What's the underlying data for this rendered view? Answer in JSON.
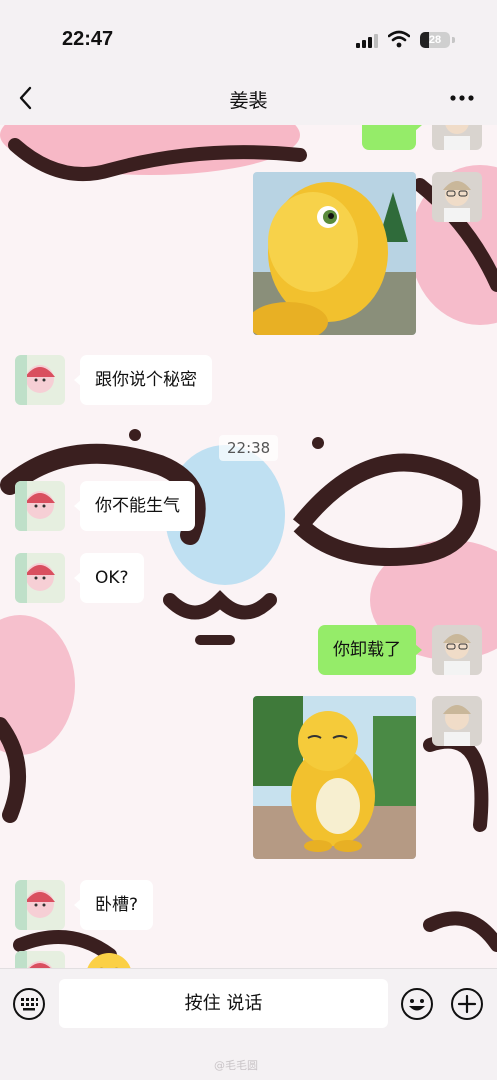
{
  "status_bar": {
    "time": "22:47",
    "battery": "28"
  },
  "header": {
    "title": "姜裴"
  },
  "messages": {
    "in_1": "跟你说个秘密",
    "timestamp": "22:38",
    "in_2": "你不能生气",
    "in_3": "OK?",
    "out_1": "你卸载了",
    "in_4": "卧槽?"
  },
  "input_bar": {
    "voice_label": "按住 说话"
  },
  "watermark": "@毛毛圆",
  "icons": {
    "back": "chevron-left-icon",
    "more": "more-dots-icon",
    "keyboard": "keyboard-icon",
    "emoji": "emoji-icon",
    "plus": "plus-icon"
  },
  "colors": {
    "outgoing_bubble": "#95ec69",
    "incoming_bubble": "#ffffff"
  }
}
